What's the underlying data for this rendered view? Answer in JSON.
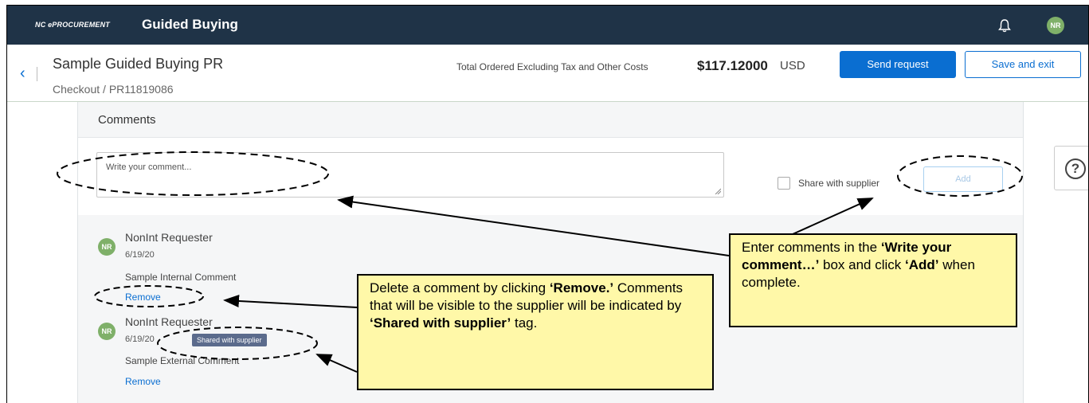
{
  "topbar": {
    "brand_small": "NC ePROCUREMENT",
    "title": "Guided Buying",
    "bell_icon": "bell-icon",
    "avatar": "NR"
  },
  "header": {
    "back_icon": "chevron-left-icon",
    "pr_title": "Sample Guided Buying PR",
    "breadcrumb": "Checkout  /  PR11819086",
    "total_label": "Total Ordered Excluding Tax and Other Costs",
    "total_value": "$117.12000",
    "total_currency": "USD",
    "send_label": "Send request",
    "save_label": "Save and exit"
  },
  "comments": {
    "title": "Comments",
    "placeholder": "Write your comment...",
    "share_label": "Share with supplier",
    "add_label": "Add",
    "items": [
      {
        "avatar": "NR",
        "name": "NonInt Requester",
        "date": "6/19/20",
        "text": "Sample Internal Comment",
        "remove": "Remove"
      },
      {
        "avatar": "NR",
        "name": "NonInt Requester",
        "date": "6/19/20",
        "tag": "Shared with supplier",
        "text": "Sample External Comment",
        "remove": "Remove"
      }
    ]
  },
  "help_icon": "question-circle-icon",
  "callouts": {
    "right": {
      "p1": "Enter comments in the ",
      "b1": "‘Write your comment…’",
      "p2": " box and click ",
      "b2": "‘Add’",
      "p3": " when complete."
    },
    "middle": {
      "p1": "Delete a comment by clicking ",
      "b1": "‘Remove.’",
      "p2": " Comments that will be visible to the supplier will be indicated by ",
      "b2": "‘Shared with supplier’",
      "p3": " tag."
    }
  },
  "colors": {
    "topbar": "#1f3347",
    "accent": "#0a6ed1",
    "avatar": "#7fb069",
    "tag": "#5b6b8c",
    "callout": "#fff8a8"
  }
}
